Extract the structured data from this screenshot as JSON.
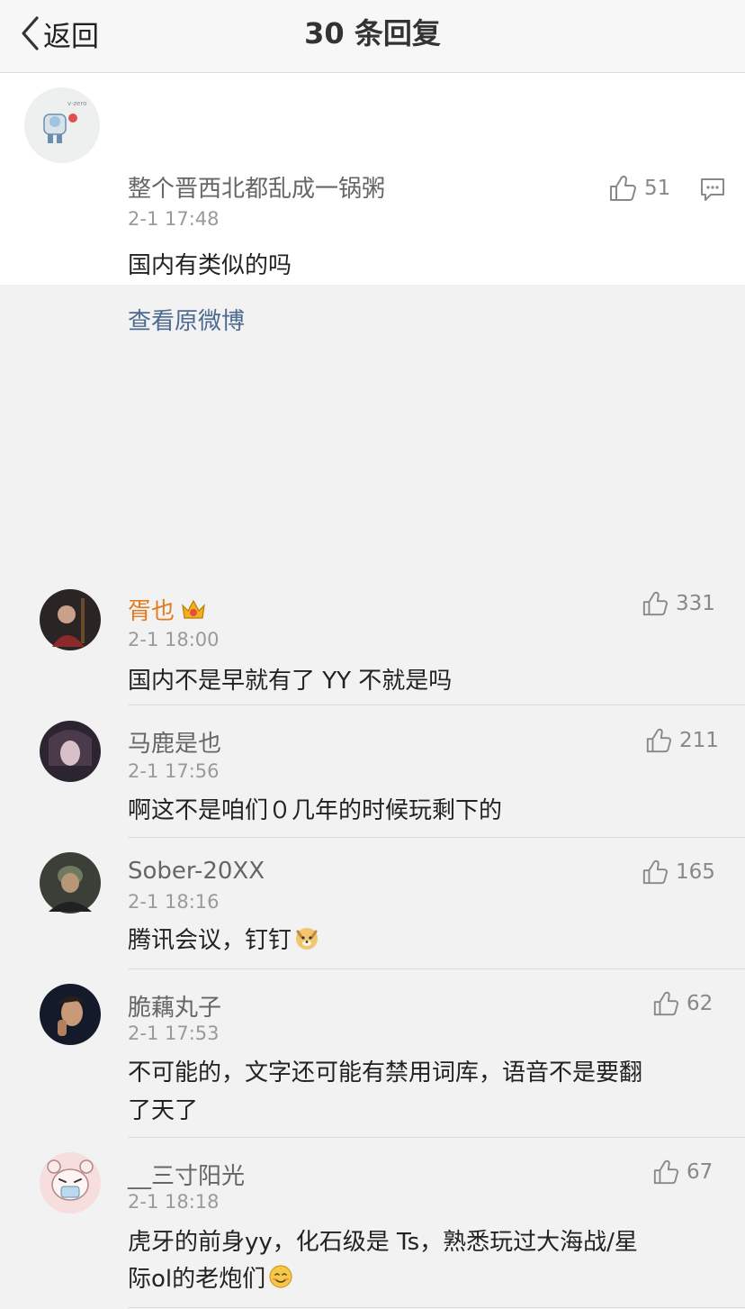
{
  "header": {
    "back_label": "返回",
    "title": "30 条回复"
  },
  "op": {
    "name": "整个晋西北都乱成一锅粥",
    "time": "2-1 17:48",
    "content": "国内有类似的吗",
    "likes": "51",
    "view_original": "查看原微博"
  },
  "comments": [
    {
      "name": "胥也",
      "time": "2-1 18:00",
      "text": "国内不是早就有了 YY 不就是吗",
      "likes": "331"
    },
    {
      "name": "马鹿是也",
      "time": "2-1 17:56",
      "text": "啊这不是咱们０几年的时候玩剩下的",
      "likes": "211"
    },
    {
      "name": "Sober-20XX",
      "time": "2-1 18:16",
      "text": "腾讯会议，钉钉",
      "likes": "165"
    },
    {
      "name": "脆藕丸子",
      "time": "2-1 17:53",
      "text_line1": "不可能的，文字还可能有禁用词库，语音不是要翻",
      "text_line2": "了天了",
      "likes": "62"
    },
    {
      "name": "__三寸阳光",
      "time": "2-1 18:18",
      "text_line1": "虎牙的前身yy，化石级是 Ts，熟悉玩过大海战/星",
      "text_line2": "际ol的老炮们",
      "likes": "67"
    }
  ],
  "colors": {
    "vip_name": "#e07b22",
    "link": "#4d6b91"
  }
}
